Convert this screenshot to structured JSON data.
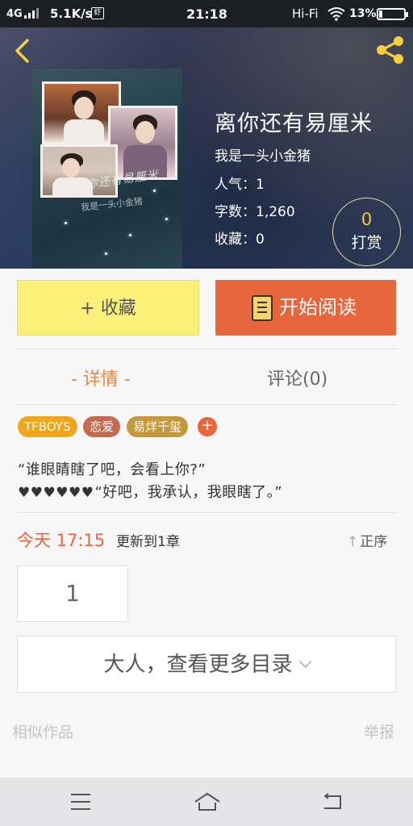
{
  "status_bar": {
    "network": "4G",
    "speed": "5.1K/s",
    "app_badge": "虾",
    "time": "21:18",
    "audio": "Hi-Fi",
    "battery": "13%",
    "battery_level": 0.13
  },
  "book": {
    "cover_text_1": "离你还有易厘米",
    "cover_text_2": "我是一头小金猪",
    "title": "离你还有易厘米",
    "author": "我是一头小金猪",
    "popularity": "人气：1",
    "word_count": "字数：1,260",
    "favorites": "收藏：0"
  },
  "tip": {
    "amount": "0",
    "label": "打赏"
  },
  "actions": {
    "favorite": "+ 收藏",
    "read": "开始阅读"
  },
  "tabs": {
    "detail": "- 详情 -",
    "comments": "评论(0)"
  },
  "tags": [
    {
      "label": "TFBOYS",
      "color": "#f0a51b"
    },
    {
      "label": "恋爱",
      "color": "#c46a4f"
    },
    {
      "label": "易烊千玺",
      "color": "#c5993b"
    }
  ],
  "tag_add": "+",
  "intro": {
    "line1": "“谁眼睛瞎了吧，会看上你?”",
    "hearts": "♥♥♥♥♥♥",
    "line2": "“好吧，我承认，我眼瞎了。”"
  },
  "update": {
    "time": "今天 17:15",
    "text": "更新到1章",
    "sort": "正序"
  },
  "chapter": "1",
  "more_catalog": "大人，查看更多目录",
  "footer": {
    "similar": "相似作品",
    "report": "举报"
  },
  "colors": {
    "accent": "#e8663b",
    "fav_button": "#fbf07a",
    "tab_active": "#e8863f"
  }
}
